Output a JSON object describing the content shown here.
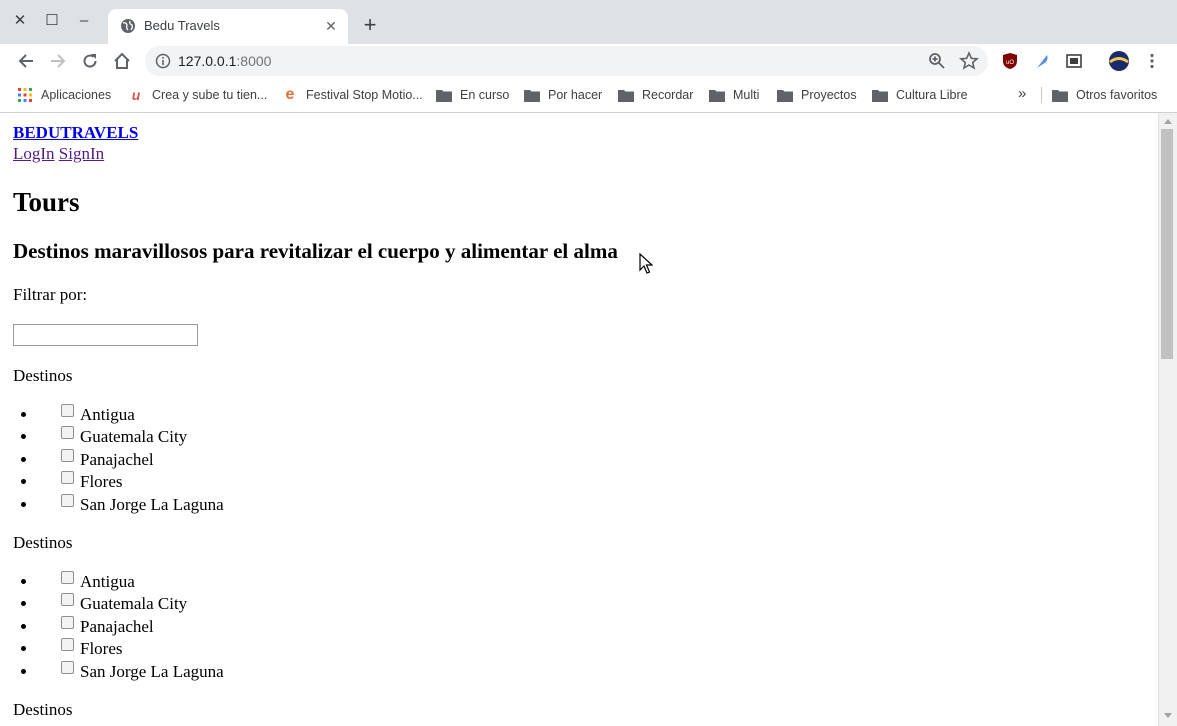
{
  "browser": {
    "tab_title": "Bedu Travels",
    "url_host": "127.0.0.1",
    "url_port": ":8000",
    "bookmarks": [
      {
        "label": "Aplicaciones",
        "icon": "apps-grid-icon"
      },
      {
        "label": "Crea y sube tu tien...",
        "icon": "site-favicon-u"
      },
      {
        "label": "Festival Stop Motio...",
        "icon": "site-favicon-e"
      },
      {
        "label": "En curso",
        "icon": "folder-icon"
      },
      {
        "label": "Por hacer",
        "icon": "folder-icon"
      },
      {
        "label": "Recordar",
        "icon": "folder-icon"
      },
      {
        "label": "Multi",
        "icon": "folder-icon"
      },
      {
        "label": "Proyectos",
        "icon": "folder-icon"
      },
      {
        "label": "Cultura Libre",
        "icon": "folder-icon"
      }
    ],
    "overflow_label": "»",
    "other_bookmarks": "Otros favoritos"
  },
  "page": {
    "brand": "BEDUTRAVELS",
    "nav": {
      "login": "LogIn",
      "signin": "SignIn"
    },
    "title": "Tours",
    "subtitle": "Destinos maravillosos para revitalizar el cuerpo y alimentar el alma",
    "filter_label": "Filtrar por:",
    "filter_value": "",
    "groups": [
      {
        "heading": "Destinos",
        "items": [
          "Antigua",
          "Guatemala City",
          "Panajachel",
          "Flores",
          "San Jorge La Laguna"
        ]
      },
      {
        "heading": "Destinos",
        "items": [
          "Antigua",
          "Guatemala City",
          "Panajachel",
          "Flores",
          "San Jorge La Laguna"
        ]
      },
      {
        "heading": "Destinos",
        "items": []
      }
    ]
  }
}
